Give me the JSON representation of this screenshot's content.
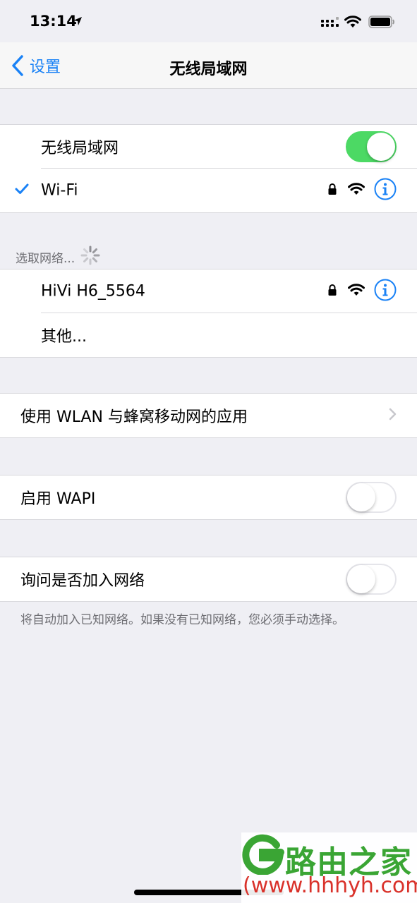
{
  "status_bar": {
    "time": "13:14"
  },
  "nav": {
    "back_label": "设置",
    "title": "无线局域网"
  },
  "wlan_group": {
    "toggle_label": "无线局域网",
    "toggle_on": true,
    "connected_network": "Wi-Fi"
  },
  "choose_network": {
    "header": "选取网络...",
    "networks": [
      "HiVi H6_5564"
    ],
    "other_label": "其他..."
  },
  "apps_row": {
    "label": "使用 WLAN 与蜂窝移动网的应用"
  },
  "wapi_row": {
    "label": "启用 WAPI",
    "toggle_on": false
  },
  "ask_join_row": {
    "label": "询问是否加入网络",
    "toggle_on": false,
    "footer": "将自动加入已知网络。如果没有已知网络，您必须手动选择。"
  },
  "watermark": {
    "name": "路由之家",
    "url": "(www.hhhyh.com)"
  },
  "colors": {
    "accent": "#1a82f6",
    "toggle_on": "#4cd964",
    "background": "#efeff4"
  }
}
